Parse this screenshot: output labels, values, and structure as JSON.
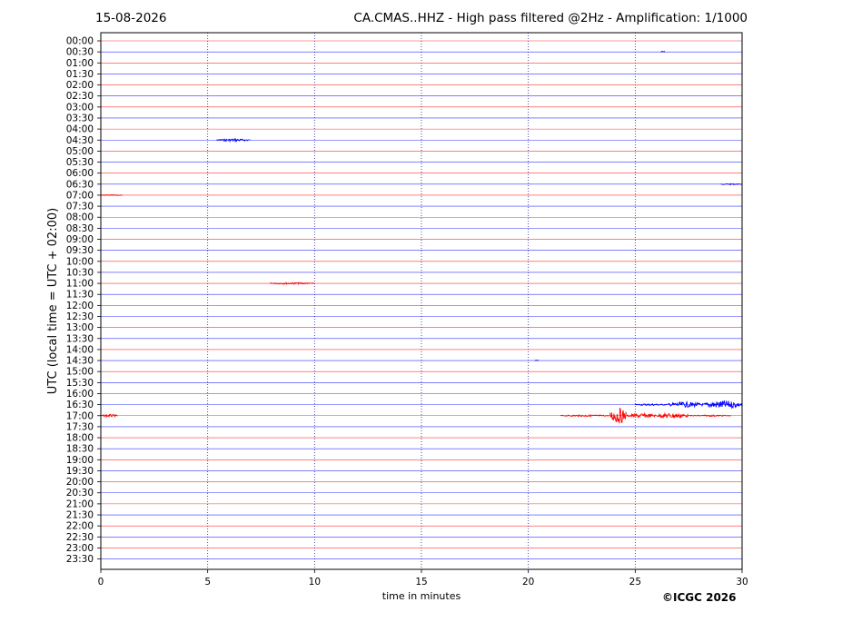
{
  "header": {
    "date": "15-08-2026",
    "title": "CA.CMAS..HHZ - High pass filtered @2Hz - Amplification: 1/1000"
  },
  "credit": "©ICGC 2026",
  "chart_data": {
    "type": "line",
    "title": "CA.CMAS..HHZ - High pass filtered @2Hz - Amplification: 1/1000",
    "xlabel": "time in minutes",
    "ylabel": "UTC (local time = UTC + 02:00)",
    "xlim": [
      0,
      30
    ],
    "xticks": [
      0,
      5,
      10,
      15,
      20,
      25,
      30
    ],
    "grid": "vertical dotted at every 5 minutes",
    "trace_colors": [
      "#ff0000",
      "#0000ff"
    ],
    "rows": [
      "00:00",
      "00:30",
      "01:00",
      "01:30",
      "02:00",
      "02:30",
      "03:00",
      "03:30",
      "04:00",
      "04:30",
      "05:00",
      "05:30",
      "06:00",
      "06:30",
      "07:00",
      "07:30",
      "08:00",
      "08:30",
      "09:00",
      "09:30",
      "10:00",
      "10:30",
      "11:00",
      "11:30",
      "12:00",
      "12:30",
      "13:00",
      "13:30",
      "14:00",
      "14:30",
      "15:00",
      "15:30",
      "16:00",
      "16:30",
      "17:00",
      "17:30",
      "18:00",
      "18:30",
      "19:00",
      "19:30",
      "20:00",
      "20:30",
      "21:00",
      "21:30",
      "22:00",
      "22:30",
      "23:00",
      "23:30"
    ],
    "events": [
      {
        "row": "00:30",
        "start": 26.2,
        "end": 26.4,
        "amplitude": 1.0
      },
      {
        "row": "04:30",
        "start": 5.4,
        "end": 7.0,
        "amplitude": 1.5
      },
      {
        "row": "06:30",
        "start": 29.0,
        "end": 30.0,
        "amplitude": 0.6
      },
      {
        "row": "07:00",
        "start": 0.0,
        "end": 1.0,
        "amplitude": 0.5
      },
      {
        "row": "11:00",
        "start": 7.9,
        "end": 10.0,
        "amplitude": 1.0
      },
      {
        "row": "14:30",
        "start": 20.3,
        "end": 20.5,
        "amplitude": 0.5
      },
      {
        "row": "16:30",
        "start": 25.0,
        "end": 26.5,
        "amplitude": 1.0
      },
      {
        "row": "16:30",
        "start": 26.5,
        "end": 28.2,
        "amplitude": 3.0
      },
      {
        "row": "16:30",
        "start": 28.2,
        "end": 30.0,
        "amplitude": 4.5
      },
      {
        "row": "17:00",
        "start": 0.0,
        "end": 0.8,
        "amplitude": 1.5
      },
      {
        "row": "17:00",
        "start": 21.5,
        "end": 23.8,
        "amplitude": 1.0
      },
      {
        "row": "17:00",
        "start": 23.8,
        "end": 24.6,
        "amplitude": 9.0
      },
      {
        "row": "17:00",
        "start": 24.6,
        "end": 26.0,
        "amplitude": 2.5
      },
      {
        "row": "17:00",
        "start": 26.0,
        "end": 27.5,
        "amplitude": 3.0
      },
      {
        "row": "17:00",
        "start": 27.5,
        "end": 29.5,
        "amplitude": 0.8
      }
    ]
  }
}
